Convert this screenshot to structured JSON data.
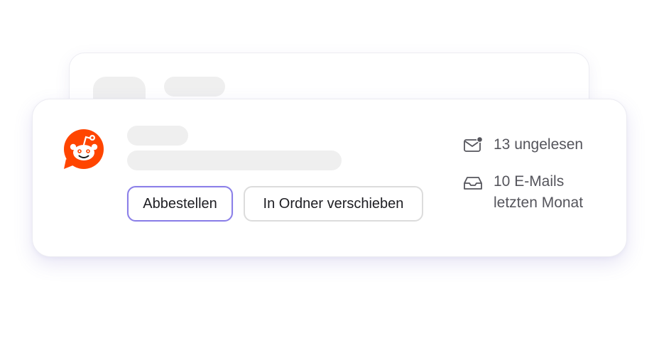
{
  "background_card": {},
  "card": {
    "sender_icon": "reddit-logo-icon",
    "actions": {
      "unsubscribe_label": "Abbestellen",
      "move_to_folder_label": "In Ordner verschieben"
    },
    "stats": {
      "unread_icon": "mail-unread-icon",
      "unread_text": "13 ungelesen",
      "monthly_icon": "inbox-tray-icon",
      "monthly_text": "10 E-Mails letzten Monat"
    }
  },
  "colors": {
    "brand_reddit": "#FF4500",
    "accent_border": "#8A7EE8",
    "skeleton": "#EFEFEF",
    "text_primary": "#1D1D22",
    "text_secondary": "#55555C"
  }
}
